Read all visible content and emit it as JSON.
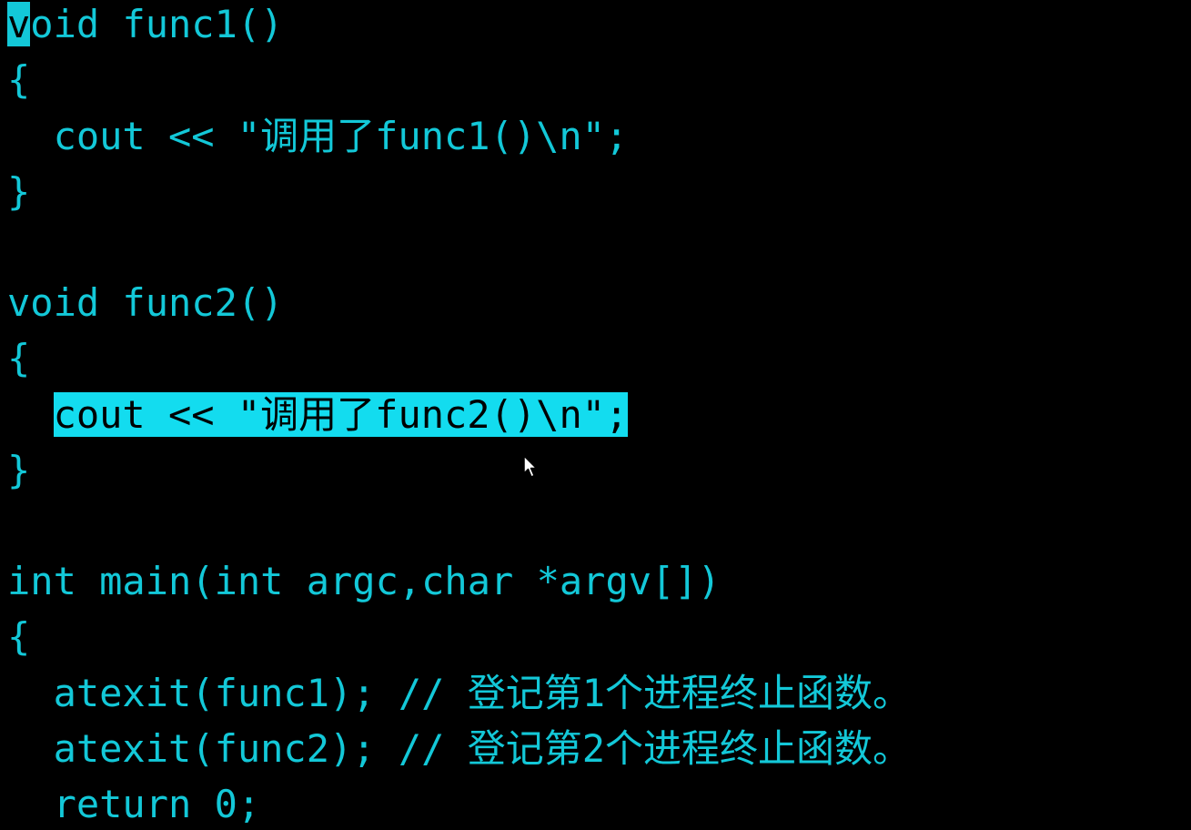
{
  "colors": {
    "background": "#000000",
    "text": "#13c8d8",
    "selection": "#13dcef"
  },
  "lines": [
    {
      "cursor_char": "v",
      "text": "oid func1()"
    },
    {
      "text": "{"
    },
    {
      "text": "  cout << \"调用了func1()\\n\";"
    },
    {
      "text": "}"
    },
    {
      "text": ""
    },
    {
      "text": "void func2()"
    },
    {
      "text": "{"
    },
    {
      "indent": "  ",
      "selected_text": "cout << \"调用了func2()\\n\";"
    },
    {
      "text": "}"
    },
    {
      "text": ""
    },
    {
      "text": "int main(int argc,char *argv[])"
    },
    {
      "text": "{"
    },
    {
      "text": "  atexit(func1); // 登记第1个进程终止函数。"
    },
    {
      "text": "  atexit(func2); // 登记第2个进程终止函数。"
    },
    {
      "text": "  return 0;"
    }
  ]
}
